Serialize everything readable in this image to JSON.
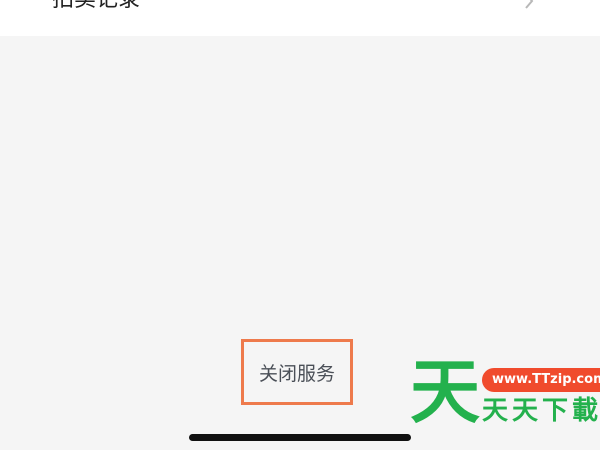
{
  "list_row": {
    "label": "拍卖记录",
    "chevron_icon": "chevron-right-icon"
  },
  "footer": {
    "close_service_label": "关闭服务",
    "highlight_color": "#ee7a4c"
  },
  "watermark": {
    "logo_char": "天",
    "url": "www.TTzip.com",
    "brand_text": "天天下載",
    "brand_color": "#23b14d",
    "url_badge_color": "#f04b2d"
  },
  "system": {
    "home_indicator_icon": "home-indicator"
  }
}
